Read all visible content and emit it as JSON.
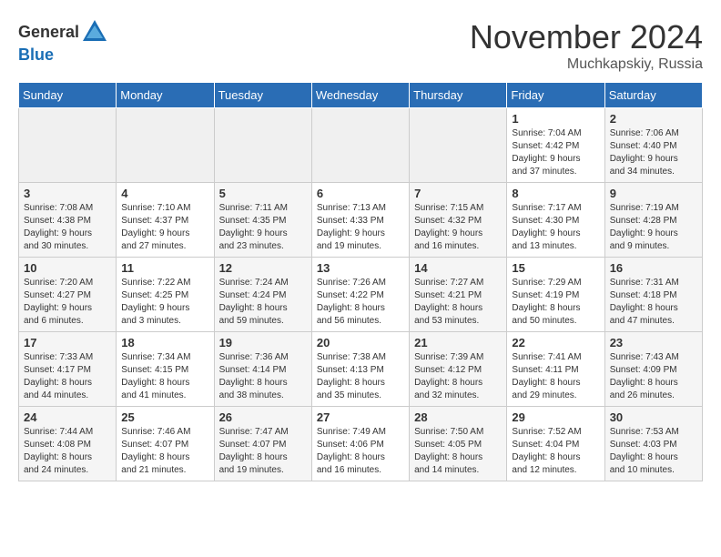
{
  "logo": {
    "general": "General",
    "blue": "Blue"
  },
  "title": {
    "month": "November 2024",
    "location": "Muchkapskiy, Russia"
  },
  "headers": [
    "Sunday",
    "Monday",
    "Tuesday",
    "Wednesday",
    "Thursday",
    "Friday",
    "Saturday"
  ],
  "weeks": [
    [
      {
        "day": "",
        "info": ""
      },
      {
        "day": "",
        "info": ""
      },
      {
        "day": "",
        "info": ""
      },
      {
        "day": "",
        "info": ""
      },
      {
        "day": "",
        "info": ""
      },
      {
        "day": "1",
        "info": "Sunrise: 7:04 AM\nSunset: 4:42 PM\nDaylight: 9 hours\nand 37 minutes."
      },
      {
        "day": "2",
        "info": "Sunrise: 7:06 AM\nSunset: 4:40 PM\nDaylight: 9 hours\nand 34 minutes."
      }
    ],
    [
      {
        "day": "3",
        "info": "Sunrise: 7:08 AM\nSunset: 4:38 PM\nDaylight: 9 hours\nand 30 minutes."
      },
      {
        "day": "4",
        "info": "Sunrise: 7:10 AM\nSunset: 4:37 PM\nDaylight: 9 hours\nand 27 minutes."
      },
      {
        "day": "5",
        "info": "Sunrise: 7:11 AM\nSunset: 4:35 PM\nDaylight: 9 hours\nand 23 minutes."
      },
      {
        "day": "6",
        "info": "Sunrise: 7:13 AM\nSunset: 4:33 PM\nDaylight: 9 hours\nand 19 minutes."
      },
      {
        "day": "7",
        "info": "Sunrise: 7:15 AM\nSunset: 4:32 PM\nDaylight: 9 hours\nand 16 minutes."
      },
      {
        "day": "8",
        "info": "Sunrise: 7:17 AM\nSunset: 4:30 PM\nDaylight: 9 hours\nand 13 minutes."
      },
      {
        "day": "9",
        "info": "Sunrise: 7:19 AM\nSunset: 4:28 PM\nDaylight: 9 hours\nand 9 minutes."
      }
    ],
    [
      {
        "day": "10",
        "info": "Sunrise: 7:20 AM\nSunset: 4:27 PM\nDaylight: 9 hours\nand 6 minutes."
      },
      {
        "day": "11",
        "info": "Sunrise: 7:22 AM\nSunset: 4:25 PM\nDaylight: 9 hours\nand 3 minutes."
      },
      {
        "day": "12",
        "info": "Sunrise: 7:24 AM\nSunset: 4:24 PM\nDaylight: 8 hours\nand 59 minutes."
      },
      {
        "day": "13",
        "info": "Sunrise: 7:26 AM\nSunset: 4:22 PM\nDaylight: 8 hours\nand 56 minutes."
      },
      {
        "day": "14",
        "info": "Sunrise: 7:27 AM\nSunset: 4:21 PM\nDaylight: 8 hours\nand 53 minutes."
      },
      {
        "day": "15",
        "info": "Sunrise: 7:29 AM\nSunset: 4:19 PM\nDaylight: 8 hours\nand 50 minutes."
      },
      {
        "day": "16",
        "info": "Sunrise: 7:31 AM\nSunset: 4:18 PM\nDaylight: 8 hours\nand 47 minutes."
      }
    ],
    [
      {
        "day": "17",
        "info": "Sunrise: 7:33 AM\nSunset: 4:17 PM\nDaylight: 8 hours\nand 44 minutes."
      },
      {
        "day": "18",
        "info": "Sunrise: 7:34 AM\nSunset: 4:15 PM\nDaylight: 8 hours\nand 41 minutes."
      },
      {
        "day": "19",
        "info": "Sunrise: 7:36 AM\nSunset: 4:14 PM\nDaylight: 8 hours\nand 38 minutes."
      },
      {
        "day": "20",
        "info": "Sunrise: 7:38 AM\nSunset: 4:13 PM\nDaylight: 8 hours\nand 35 minutes."
      },
      {
        "day": "21",
        "info": "Sunrise: 7:39 AM\nSunset: 4:12 PM\nDaylight: 8 hours\nand 32 minutes."
      },
      {
        "day": "22",
        "info": "Sunrise: 7:41 AM\nSunset: 4:11 PM\nDaylight: 8 hours\nand 29 minutes."
      },
      {
        "day": "23",
        "info": "Sunrise: 7:43 AM\nSunset: 4:09 PM\nDaylight: 8 hours\nand 26 minutes."
      }
    ],
    [
      {
        "day": "24",
        "info": "Sunrise: 7:44 AM\nSunset: 4:08 PM\nDaylight: 8 hours\nand 24 minutes."
      },
      {
        "day": "25",
        "info": "Sunrise: 7:46 AM\nSunset: 4:07 PM\nDaylight: 8 hours\nand 21 minutes."
      },
      {
        "day": "26",
        "info": "Sunrise: 7:47 AM\nSunset: 4:07 PM\nDaylight: 8 hours\nand 19 minutes."
      },
      {
        "day": "27",
        "info": "Sunrise: 7:49 AM\nSunset: 4:06 PM\nDaylight: 8 hours\nand 16 minutes."
      },
      {
        "day": "28",
        "info": "Sunrise: 7:50 AM\nSunset: 4:05 PM\nDaylight: 8 hours\nand 14 minutes."
      },
      {
        "day": "29",
        "info": "Sunrise: 7:52 AM\nSunset: 4:04 PM\nDaylight: 8 hours\nand 12 minutes."
      },
      {
        "day": "30",
        "info": "Sunrise: 7:53 AM\nSunset: 4:03 PM\nDaylight: 8 hours\nand 10 minutes."
      }
    ]
  ]
}
